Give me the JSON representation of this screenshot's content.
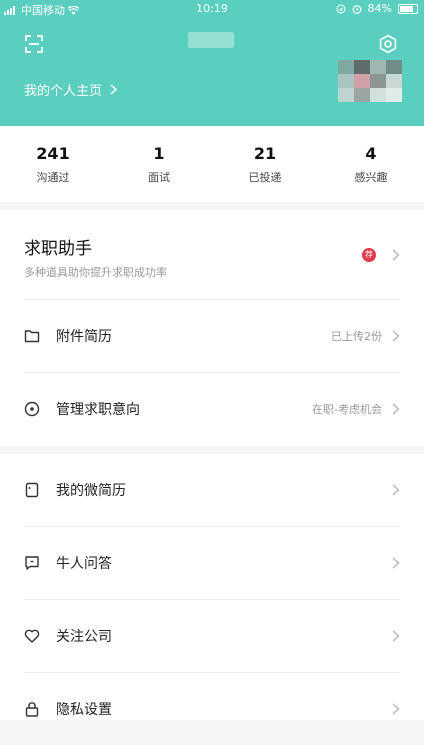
{
  "status_bar": {
    "carrier": "中国移动",
    "time": "10:19",
    "battery": "84%",
    "battery_level": 0.84
  },
  "header": {
    "profile_link": "我的个人主页"
  },
  "stats": [
    {
      "value": "241",
      "label": "沟通过"
    },
    {
      "value": "1",
      "label": "面试"
    },
    {
      "value": "21",
      "label": "已投递"
    },
    {
      "value": "4",
      "label": "感兴趣"
    }
  ],
  "assistant": {
    "title": "求职助手",
    "subtitle": "多种道具助你提升求职成功率",
    "badge": "荐"
  },
  "menu1": [
    {
      "label": "附件简历",
      "value": "已上传2份",
      "icon": "folder-icon"
    },
    {
      "label": "管理求职意向",
      "value": "在职-考虑机会",
      "icon": "target-icon"
    }
  ],
  "menu2": [
    {
      "label": "我的微简历",
      "icon": "document-icon"
    },
    {
      "label": "牛人问答",
      "icon": "chat-icon"
    },
    {
      "label": "关注公司",
      "icon": "heart-icon"
    },
    {
      "label": "隐私设置",
      "icon": "lock-icon"
    }
  ],
  "colors": {
    "brand": "#5bcfbf",
    "badge": "#e23a4a"
  }
}
